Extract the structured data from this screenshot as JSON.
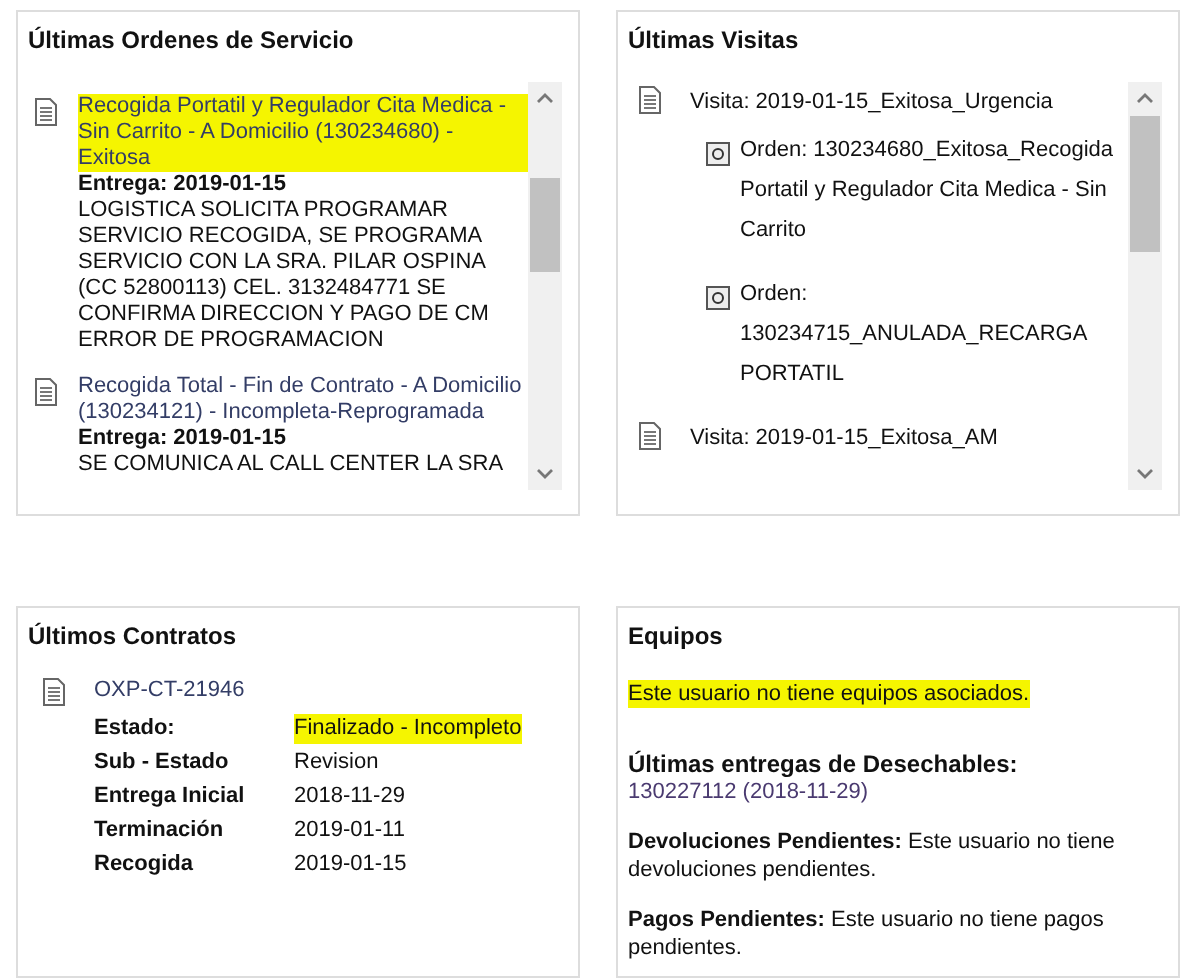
{
  "orders_panel": {
    "title": "Últimas Ordenes de Servicio",
    "orders": [
      {
        "title": "Recogida Portatil y Regulador Cita Medica - Sin Carrito - A Domicilio (130234680) - Exitosa",
        "highlighted": true,
        "delivery": "Entrega: 2019-01-15",
        "notes": [
          "LOGISTICA SOLICITA PROGRAMAR SERVICIO RECOGIDA, SE PROGRAMA SERVICIO CON LA SRA. PILAR OSPINA (CC 52800113) CEL. 3132484771 SE CONFIRMA DIRECCION Y PAGO DE CM",
          "ERROR DE PROGRAMACION"
        ]
      },
      {
        "title": "Recogida Total - Fin de Contrato - A Domicilio (130234121) - Incompleta-Reprogramada",
        "highlighted": false,
        "delivery": "Entrega: 2019-01-15",
        "notes": [
          "SE COMUNICA AL CALL CENTER LA SRA"
        ]
      }
    ]
  },
  "visits_panel": {
    "title": "Últimas Visitas",
    "visits": [
      {
        "label": "Visita: 2019-01-15_Exitosa_Urgencia",
        "children": [
          {
            "label": "Orden: 130234680_Exitosa_Recogida Portatil y Regulador Cita Medica - Sin Carrito"
          },
          {
            "label": "Orden: 130234715_ANULADA_RECARGA PORTATIL"
          }
        ]
      },
      {
        "label": "Visita: 2019-01-15_Exitosa_AM"
      }
    ]
  },
  "contracts_panel": {
    "title": "Últimos Contratos",
    "contracts": [
      {
        "code": "OXP-CT-21946",
        "fields": [
          {
            "label": "Estado:",
            "value": "Finalizado - Incompleto",
            "highlighted": true
          },
          {
            "label": "Sub - Estado",
            "value": "Revision",
            "highlighted": false
          },
          {
            "label": "Entrega Inicial",
            "value": "2018-11-29",
            "highlighted": false
          },
          {
            "label": "Terminación",
            "value": "2019-01-11",
            "highlighted": false
          },
          {
            "label": "Recogida",
            "value": "2019-01-15",
            "highlighted": false
          }
        ]
      }
    ]
  },
  "equipment_panel": {
    "title": "Equipos",
    "message": "Este usuario no tiene equipos asociados.",
    "message_highlighted": true,
    "deliveries_label": "Últimas entregas de Desechables:",
    "deliveries_link": "130227112 (2018-11-29)",
    "returns": "**Devoluciones Pendientes:** Este usuario no tiene devoluciones pendientes.",
    "payments": "**Pagos Pendientes:** Este usuario no tiene pagos pendientes."
  }
}
